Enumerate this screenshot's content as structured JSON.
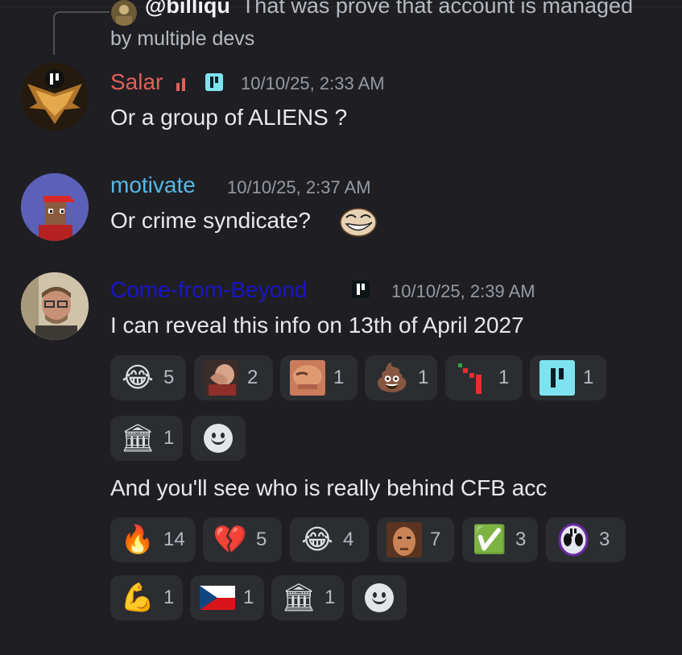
{
  "reply": {
    "username": "@billiqu",
    "text_line1": "That was prove that account is managed",
    "text_line2": "by multiple devs"
  },
  "messages": [
    {
      "username": "Salar",
      "username_color": "#e0605a",
      "timestamp": "10/10/25, 2:33 AM",
      "text": "Or a group of ALIENS ?"
    },
    {
      "username": "motivate",
      "username_color": "#59b7e6",
      "timestamp": "10/10/25, 2:37 AM",
      "text": "Or crime syndicate?",
      "inline_emoji": "troll-face"
    },
    {
      "username": "Come-from-Beyond",
      "username_color": "#1a14c9",
      "timestamp": "10/10/25, 2:39 AM",
      "text": "I can reveal this info on 13th of April 2027",
      "reactions": [
        {
          "emoji": "😂",
          "icon": "joy-icon",
          "count": "5"
        },
        {
          "emoji": "",
          "icon": "facepalm-icon",
          "count": "2"
        },
        {
          "emoji": "",
          "icon": "face-closeup-icon",
          "count": "1"
        },
        {
          "emoji": "💩",
          "icon": "poop-icon",
          "count": "1"
        },
        {
          "emoji": "",
          "icon": "red-logo-icon",
          "count": "1"
        },
        {
          "emoji": "",
          "icon": "qubic-logo-icon",
          "count": "1"
        },
        {
          "emoji": "🏛",
          "icon": "church-icon",
          "count": "1"
        }
      ],
      "followup_text": "And you'll see who is really behind CFB acc",
      "followup_reactions": [
        {
          "emoji": "🔥",
          "icon": "fire-icon",
          "count": "14"
        },
        {
          "emoji": "💔",
          "icon": "broken-heart-icon",
          "count": "5"
        },
        {
          "emoji": "😂",
          "icon": "joy-icon",
          "count": "4"
        },
        {
          "emoji": "",
          "icon": "face-closeup-icon",
          "count": "7"
        },
        {
          "emoji": "✅",
          "icon": "check-mark-icon",
          "count": "3"
        },
        {
          "emoji": "",
          "icon": "alien-icon",
          "count": "3"
        },
        {
          "emoji": "💪",
          "icon": "flexed-biceps-icon",
          "count": "1"
        },
        {
          "emoji": "",
          "icon": "czech-flag-icon",
          "count": "1"
        },
        {
          "emoji": "🏛",
          "icon": "church-icon",
          "count": "1"
        }
      ]
    }
  ],
  "colors": {
    "background": "#1f1f23",
    "reaction_bg": "#2b2d31",
    "badge_bg": "#7fe3ef",
    "timestamp": "#949ba4"
  }
}
